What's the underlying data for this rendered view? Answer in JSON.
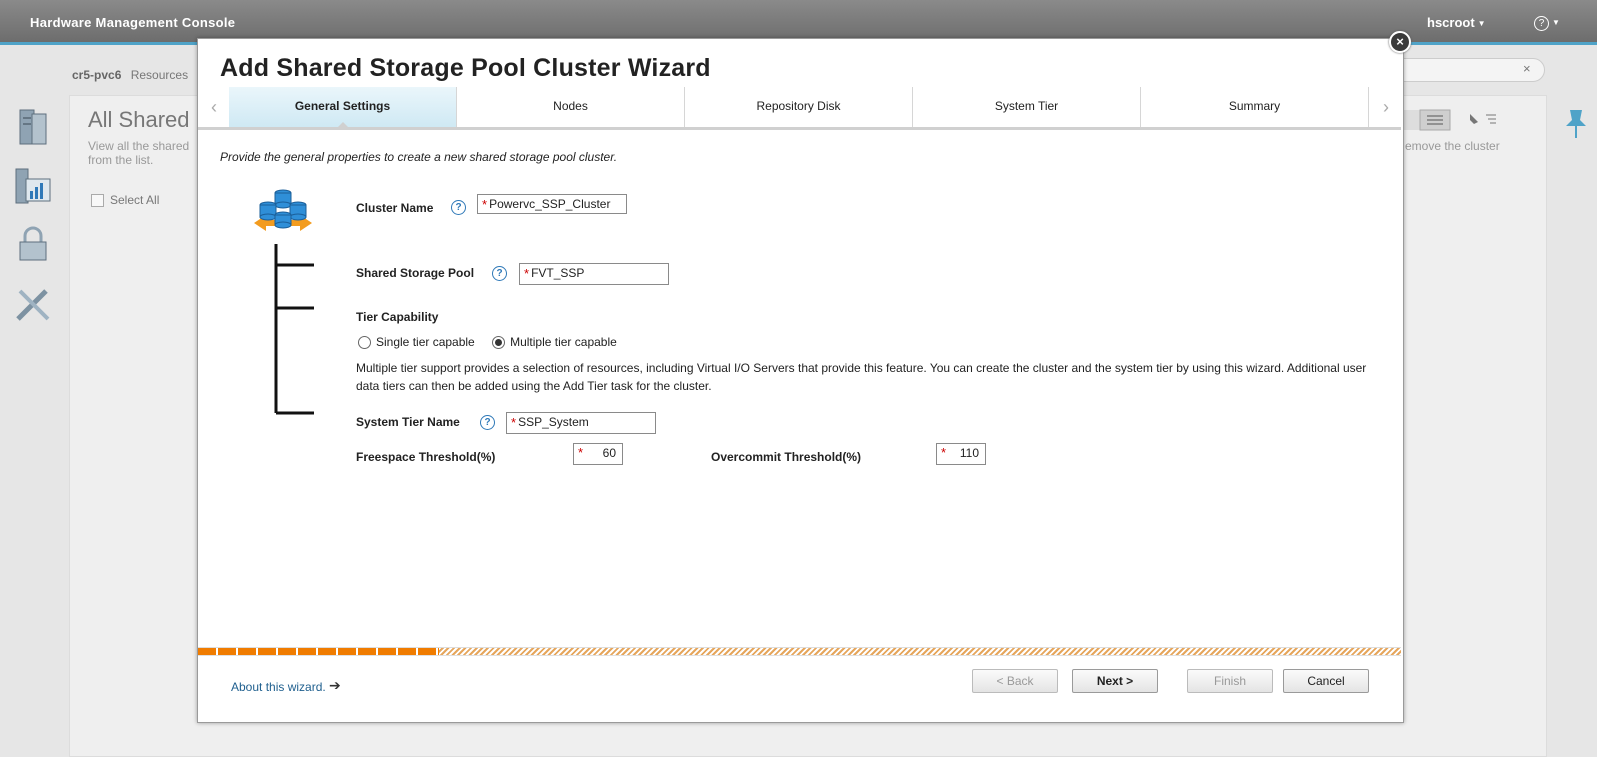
{
  "console": {
    "title": "Hardware Management Console",
    "user": "hscroot",
    "help": "?",
    "breadcrumb_system": "cr5-pvc6",
    "breadcrumb_section": "Resources",
    "page_heading": "All Shared",
    "page_desc": "View all the shared from the list.",
    "page_desc_right": "emove the cluster",
    "select_all": "Select All",
    "search_placeholder": "h",
    "search_clear": "×"
  },
  "wizard": {
    "title": "Add Shared Storage Pool Cluster Wizard",
    "close": "×",
    "tabs": [
      {
        "label": "General Settings",
        "active": true
      },
      {
        "label": "Nodes"
      },
      {
        "label": "Repository Disk"
      },
      {
        "label": "System Tier"
      },
      {
        "label": "Summary"
      }
    ],
    "tab_prev": "‹",
    "tab_next": "›",
    "intro": "Provide the general properties to create a new shared storage pool cluster.",
    "fields": {
      "cluster_name_label": "Cluster Name",
      "cluster_name_value": "Powervc_SSP_Cluster",
      "pool_label": "Shared Storage Pool",
      "pool_value": "FVT_SSP",
      "tier_capability_label": "Tier Capability",
      "single_tier": "Single tier capable",
      "multiple_tier": "Multiple tier capable",
      "selected_tier_option": "multiple",
      "tier_desc": "Multiple tier support provides a selection of resources, including Virtual I/O Servers that provide this feature. You can create the cluster and the system tier by using this wizard. Additional user data tiers can then be added using the Add Tier task for the cluster.",
      "system_tier_label": "System Tier Name",
      "system_tier_value": "SSP_System",
      "freespace_label": "Freespace Threshold(%)",
      "freespace_value": "60",
      "overcommit_label": "Overcommit Threshold(%)",
      "overcommit_value": "110",
      "required_mark": "*",
      "help_mark": "?"
    },
    "progress_fraction": 0.2,
    "footer": {
      "about": "About this wizard.",
      "about_arrow": "➔",
      "back": "< Back",
      "next": "Next >",
      "finish": "Finish",
      "cancel": "Cancel"
    }
  },
  "colors": {
    "accent_blue": "#4fa3c8",
    "progress_orange": "#f07c00",
    "link_blue": "#1f5f8e",
    "required_red": "#cc0000"
  }
}
